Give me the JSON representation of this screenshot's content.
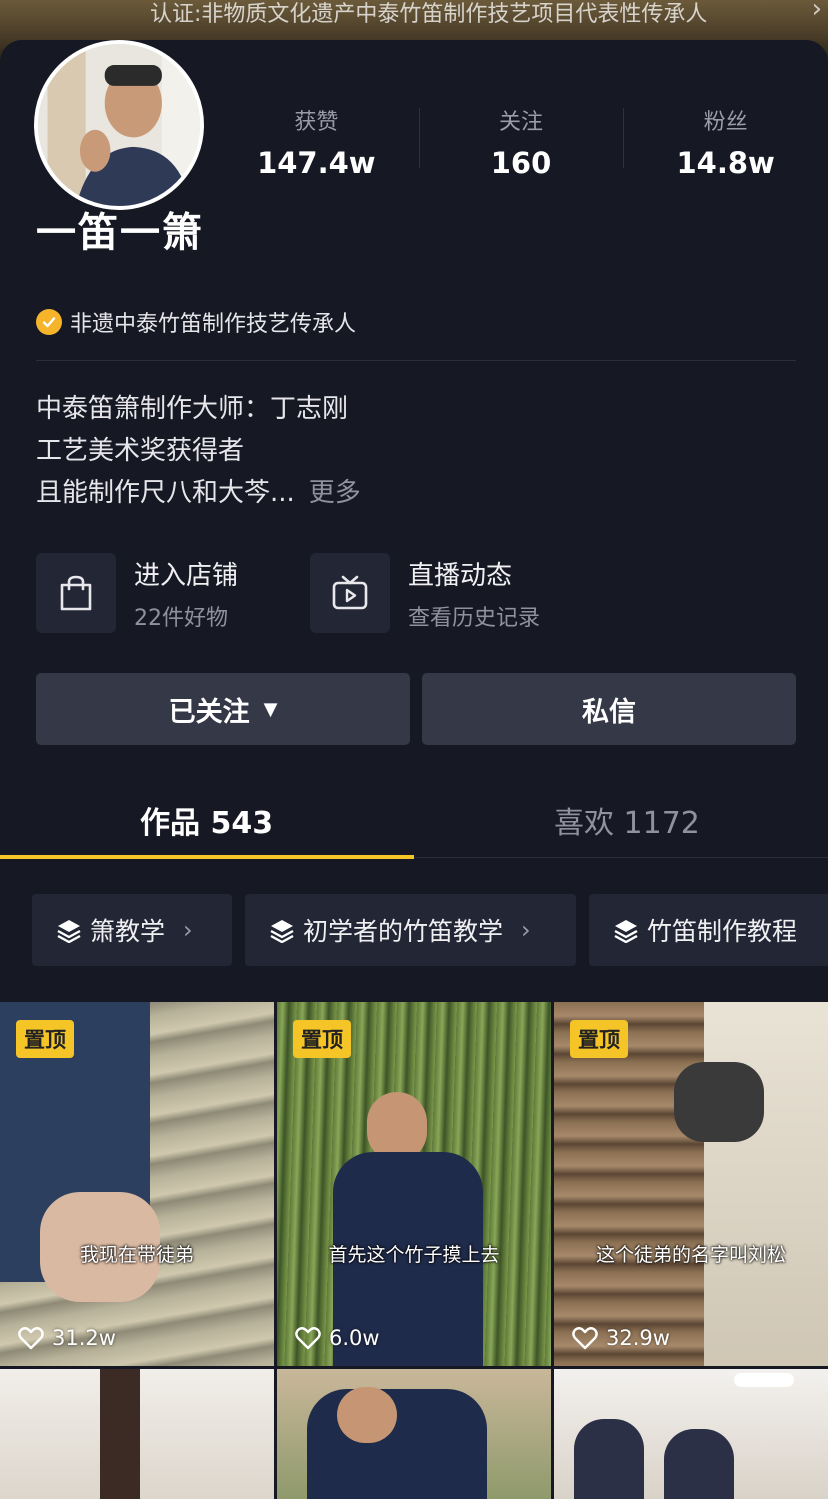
{
  "banner": {
    "text": "认证:非物质文化遗产中泰竹笛制作技艺项目代表性传承人",
    "chevron": "›"
  },
  "profile": {
    "name": "一笛一箫",
    "verified": "非遗中泰竹笛制作技艺传承人",
    "stats": [
      {
        "label": "获赞",
        "value": "147.4w"
      },
      {
        "label": "关注",
        "value": "160"
      },
      {
        "label": "粉丝",
        "value": "14.8w"
      }
    ],
    "bio": {
      "line1": "中泰笛箫制作大师：丁志刚",
      "line2": "工艺美术奖获得者",
      "line3": "且能制作尺八和大芩...",
      "more": "更多"
    }
  },
  "entries": [
    {
      "title": "进入店铺",
      "subtitle": "22件好物",
      "icon": "shopping-bag-icon"
    },
    {
      "title": "直播动态",
      "subtitle": "查看历史记录",
      "icon": "tv-play-icon"
    }
  ],
  "actions": {
    "follow": "已关注",
    "follow_caret": "▼",
    "message": "私信"
  },
  "tabs": {
    "works": "作品 543",
    "likes": "喜欢 1172"
  },
  "collections": [
    {
      "label": "箫教学"
    },
    {
      "label": "初学者的竹笛教学"
    },
    {
      "label": "竹笛制作教程"
    }
  ],
  "videos": [
    {
      "pinned": "置顶",
      "caption": "我现在带徒弟",
      "likes": "31.2w"
    },
    {
      "pinned": "置顶",
      "caption": "首先这个竹子摸上去",
      "likes": "6.0w"
    },
    {
      "pinned": "置顶",
      "caption": "这个徒弟的名字叫刘松",
      "likes": "32.9w"
    }
  ],
  "colors": {
    "accent": "#f5c527",
    "verify": "#f5b42a",
    "background": "#161824",
    "button": "#353847"
  }
}
